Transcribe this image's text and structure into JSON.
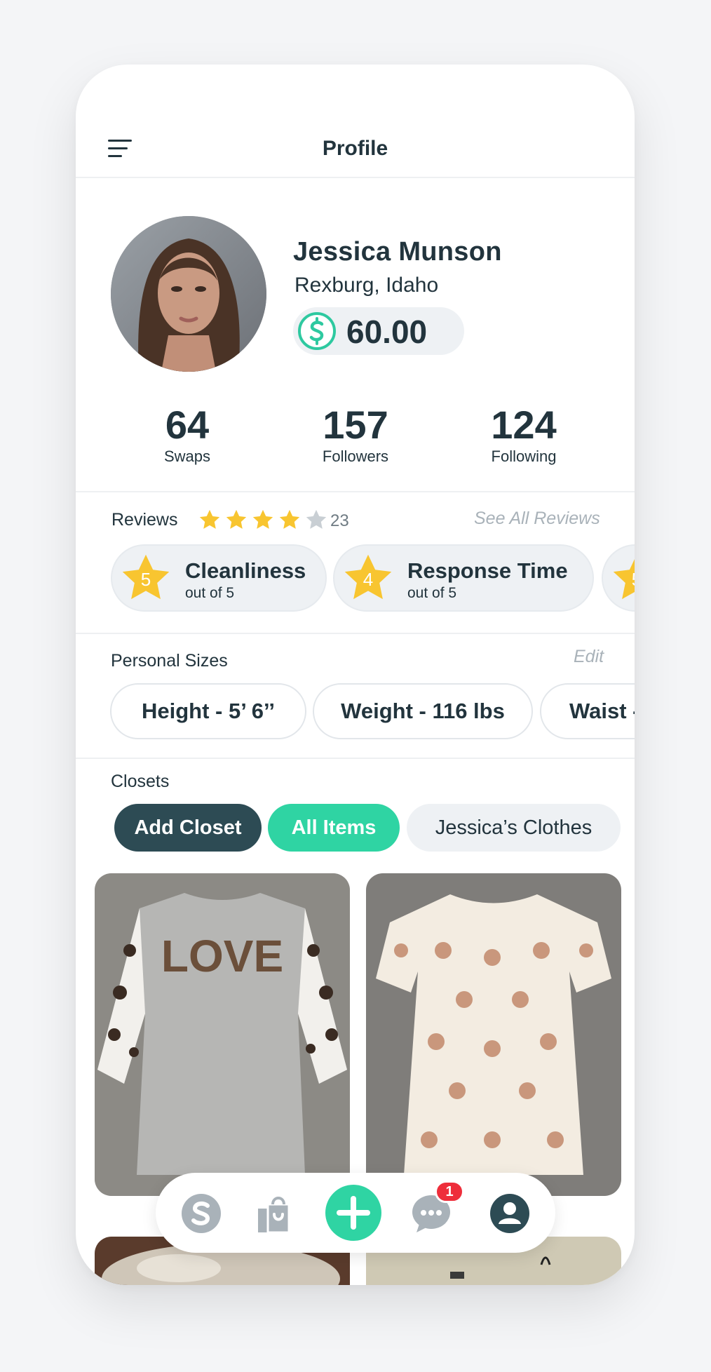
{
  "header": {
    "title": "Profile"
  },
  "profile": {
    "name": "Jessica Munson",
    "location": "Rexburg, Idaho",
    "balance": "60.00"
  },
  "stats": [
    {
      "value": "64",
      "label": "Swaps"
    },
    {
      "value": "157",
      "label": "Followers"
    },
    {
      "value": "124",
      "label": "Following"
    }
  ],
  "reviews": {
    "label": "Reviews",
    "rating": 4,
    "max": 5,
    "count": "23",
    "see_all": "See All Reviews",
    "categories": [
      {
        "score": "5",
        "title": "Cleanliness",
        "sub": "out of 5"
      },
      {
        "score": "4",
        "title": "Response Time",
        "sub": "out of 5"
      },
      {
        "score": "5",
        "title": "",
        "sub": ""
      }
    ]
  },
  "sizes": {
    "label": "Personal Sizes",
    "edit": "Edit",
    "items": [
      "Height - 5’ 6’’",
      "Weight - 116 lbs",
      "Waist -"
    ]
  },
  "closets": {
    "label": "Closets",
    "buttons": [
      "Add Closet",
      "All Items",
      "Jessica’s Clothes"
    ]
  },
  "items": [
    {
      "name": "love-leopard-sleeve-dress-photo"
    },
    {
      "name": "floral-tshirt-dress-photo"
    },
    {
      "name": "fur-item-photo"
    },
    {
      "name": "carpet-item-photo"
    }
  ],
  "tabbar": {
    "tabs": [
      "swap-logo-icon",
      "shopping-bag-icon",
      "add-icon",
      "chat-icon",
      "user-icon"
    ],
    "chat_badge": "1"
  },
  "colors": {
    "accent": "#2fd4a3",
    "dark": "#2d4b54",
    "star": "#f8c530",
    "badge": "#ee2e3b"
  }
}
